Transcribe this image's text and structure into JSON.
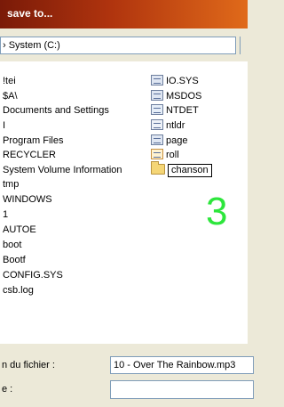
{
  "window": {
    "title": "save to..."
  },
  "location": {
    "value": "› System (C:)"
  },
  "files": {
    "left": [
      "!tei",
      "$A\\",
      "Documents and Settings",
      "I",
      "Program Files",
      "RECYCLER",
      "System Volume Information",
      "tmp",
      "WINDOWS",
      "1",
      "AUTOE",
      "boot",
      "Bootf",
      "CONFIG.SYS",
      "csb.log"
    ],
    "right": [
      {
        "name": "IO.SYS",
        "icon": "sys-file-icon"
      },
      {
        "name": "MSDOS",
        "icon": "sys-file-icon"
      },
      {
        "name": "NTDET",
        "icon": "file-icon"
      },
      {
        "name": "ntldr",
        "icon": "file-icon"
      },
      {
        "name": "page",
        "icon": "sys-file-icon"
      },
      {
        "name": "roll",
        "icon": "program-file-icon"
      },
      {
        "name": "chanson",
        "icon": "folder-icon"
      }
    ]
  },
  "overlay": {
    "number": "3"
  },
  "form": {
    "filename_label": "n du fichier :",
    "filename_value": "10 - Over The Rainbow.mp3",
    "type_label": "e :",
    "type_value": ""
  }
}
